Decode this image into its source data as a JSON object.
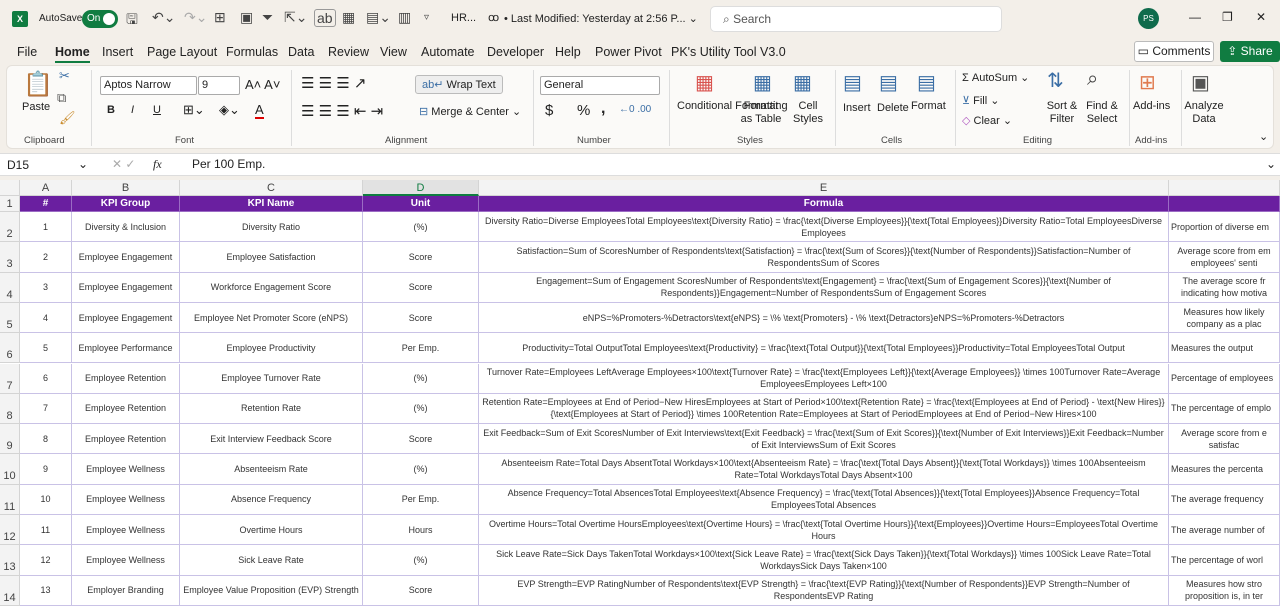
{
  "titlebar": {
    "app_icon": "X",
    "autosave_label": "AutoSave",
    "autosave_state": "On",
    "filename": "HR...",
    "last_modified": "• Last Modified: Yesterday at 2:56 P... ⌄",
    "search_placeholder": "Search",
    "avatar": "PS",
    "minimize": "—",
    "restore": "❐",
    "close": "✕"
  },
  "tabs": [
    "File",
    "Home",
    "Insert",
    "Page Layout",
    "Formulas",
    "Data",
    "Review",
    "View",
    "Automate",
    "Developer",
    "Help",
    "Power Pivot",
    "PK's Utility Tool V3.0"
  ],
  "active_tab": "Home",
  "comments_label": "Comments",
  "share_label": "Share",
  "ribbon": {
    "clipboard": {
      "paste": "Paste",
      "group": "Clipboard"
    },
    "font": {
      "name": "Aptos Narrow",
      "size": "9",
      "bold": "B",
      "italic": "I",
      "underline": "U",
      "group": "Font"
    },
    "alignment": {
      "wrap": "Wrap Text",
      "merge": "Merge & Center",
      "group": "Alignment"
    },
    "number": {
      "format": "General",
      "currency": "$",
      "percent": "%",
      "comma": ",",
      "group": "Number"
    },
    "styles": {
      "conditional": "Conditional Formatting",
      "format_table": "Format as Table",
      "cell_styles": "Cell Styles",
      "group": "Styles"
    },
    "cells": {
      "insert": "Insert",
      "delete": "Delete",
      "format": "Format",
      "group": "Cells"
    },
    "editing": {
      "autosum": "AutoSum",
      "fill": "Fill",
      "clear": "Clear",
      "sort": "Sort & Filter",
      "find": "Find & Select",
      "group": "Editing"
    },
    "addins": {
      "addins": "Add-ins",
      "group": "Add-ins"
    },
    "analyze": {
      "label": "Analyze Data"
    }
  },
  "formula_bar": {
    "name_box": "D15",
    "fx": "fx",
    "value": "Per 100 Emp."
  },
  "columns": [
    "A",
    "B",
    "C",
    "D",
    "E",
    ""
  ],
  "selected_column": "D",
  "header": [
    "#",
    "KPI Group",
    "KPI Name",
    "Unit",
    "Formula",
    ""
  ],
  "rows": [
    [
      "1",
      "Diversity & Inclusion",
      "Diversity Ratio",
      "(%)",
      "Diversity Ratio=Diverse EmployeesTotal Employees\\text{Diversity Ratio} = \\frac{\\text{Diverse Employees}}{\\text{Total Employees}}Diversity Ratio=Total EmployeesDiverse Employees",
      "Proportion of diverse em"
    ],
    [
      "2",
      "Employee Engagement",
      "Employee Satisfaction",
      "Score",
      "Satisfaction=Sum of ScoresNumber of Respondents\\text{Satisfaction} = \\frac{\\text{Sum of Scores}}{\\text{Number of Respondents}}Satisfaction=Number of RespondentsSum of Scores",
      "Average score from em employees' senti"
    ],
    [
      "3",
      "Employee Engagement",
      "Workforce Engagement Score",
      "Score",
      "Engagement=Sum of Engagement ScoresNumber of Respondents\\text{Engagement} = \\frac{\\text{Sum of Engagement Scores}}{\\text{Number of Respondents}}Engagement=Number of RespondentsSum of Engagement Scores",
      "The average score fr indicating how motiva"
    ],
    [
      "4",
      "Employee Engagement",
      "Employee Net Promoter Score (eNPS)",
      "Score",
      "eNPS=%Promoters-%Detractors\\text{eNPS} = \\% \\text{Promoters} - \\% \\text{Detractors}eNPS=%Promoters-%Detractors",
      "Measures how likely company as a plac"
    ],
    [
      "5",
      "Employee Performance",
      "Employee Productivity",
      "Per Emp.",
      "Productivity=Total OutputTotal Employees\\text{Productivity} = \\frac{\\text{Total Output}}{\\text{Total Employees}}Productivity=Total EmployeesTotal Output",
      "Measures the output"
    ],
    [
      "6",
      "Employee Retention",
      "Employee Turnover Rate",
      "(%)",
      "Turnover Rate=Employees LeftAverage Employees×100\\text{Turnover Rate} = \\frac{\\text{Employees Left}}{\\text{Average Employees}} \\times 100Turnover Rate=Average EmployeesEmployees Left×100",
      "Percentage of employees"
    ],
    [
      "7",
      "Employee Retention",
      "Retention Rate",
      "(%)",
      "Retention Rate=Employees at End of Period−New HiresEmployees at Start of Period×100\\text{Retention Rate} = \\frac{\\text{Employees at End of Period} - \\text{New Hires}}{\\text{Employees at Start of Period}} \\times 100Retention Rate=Employees at Start of PeriodEmployees at End of Period−New Hires×100",
      "The percentage of emplo"
    ],
    [
      "8",
      "Employee Retention",
      "Exit Interview Feedback Score",
      "Score",
      "Exit Feedback=Sum of Exit ScoresNumber of Exit Interviews\\text{Exit Feedback} = \\frac{\\text{Sum of Exit Scores}}{\\text{Number of Exit Interviews}}Exit Feedback=Number of Exit InterviewsSum of Exit Scores",
      "Average score from e satisfac"
    ],
    [
      "9",
      "Employee Wellness",
      "Absenteeism Rate",
      "(%)",
      "Absenteeism Rate=Total Days AbsentTotal Workdays×100\\text{Absenteeism Rate} = \\frac{\\text{Total Days Absent}}{\\text{Total Workdays}} \\times 100Absenteeism Rate=Total WorkdaysTotal Days Absent×100",
      "Measures the percenta"
    ],
    [
      "10",
      "Employee Wellness",
      "Absence Frequency",
      "Per Emp.",
      "Absence Frequency=Total AbsencesTotal Employees\\text{Absence Frequency} = \\frac{\\text{Total Absences}}{\\text{Total Employees}}Absence Frequency=Total EmployeesTotal Absences",
      "The average frequency"
    ],
    [
      "11",
      "Employee Wellness",
      "Overtime Hours",
      "Hours",
      "Overtime Hours=Total Overtime HoursEmployees\\text{Overtime Hours} = \\frac{\\text{Total Overtime Hours}}{\\text{Employees}}Overtime Hours=EmployeesTotal Overtime Hours",
      "The average number of"
    ],
    [
      "12",
      "Employee Wellness",
      "Sick Leave Rate",
      "(%)",
      "Sick Leave Rate=Sick Days TakenTotal Workdays×100\\text{Sick Leave Rate} = \\frac{\\text{Sick Days Taken}}{\\text{Total Workdays}} \\times 100Sick Leave Rate=Total WorkdaysSick Days Taken×100",
      "The percentage of worl"
    ],
    [
      "13",
      "Employer Branding",
      "Employee Value Proposition (EVP) Strength",
      "Score",
      "EVP Strength=EVP RatingNumber of Respondents\\text{EVP Strength} = \\frac{\\text{EVP Rating}}{\\text{Number of Respondents}}EVP Strength=Number of RespondentsEVP Rating",
      "Measures how stro proposition is, in ter"
    ]
  ],
  "colors": {
    "header_bg": "#6a1fa0",
    "accent": "#107c41"
  }
}
